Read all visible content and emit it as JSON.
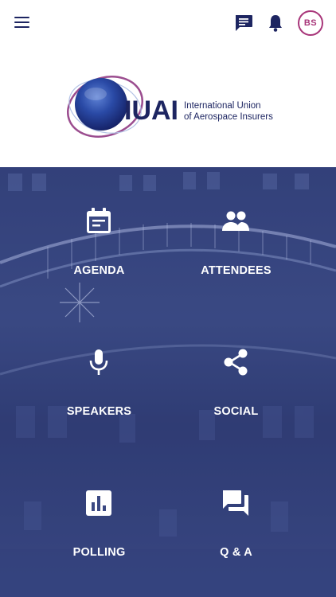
{
  "header": {
    "avatar_initials": "BS",
    "accent_color": "#a8367a",
    "icon_color": "#1d2561"
  },
  "logo": {
    "acronym": "IUAI",
    "line1": "International Union",
    "line2": "of Aerospace Insurers"
  },
  "tiles": [
    {
      "label": "AGENDA",
      "icon": "calendar-icon"
    },
    {
      "label": "ATTENDEES",
      "icon": "people-icon"
    },
    {
      "label": "SPEAKERS",
      "icon": "microphone-icon"
    },
    {
      "label": "SOCIAL",
      "icon": "share-icon"
    },
    {
      "label": "POLLING",
      "icon": "bar-chart-icon"
    },
    {
      "label": "Q & A",
      "icon": "forum-icon"
    }
  ]
}
